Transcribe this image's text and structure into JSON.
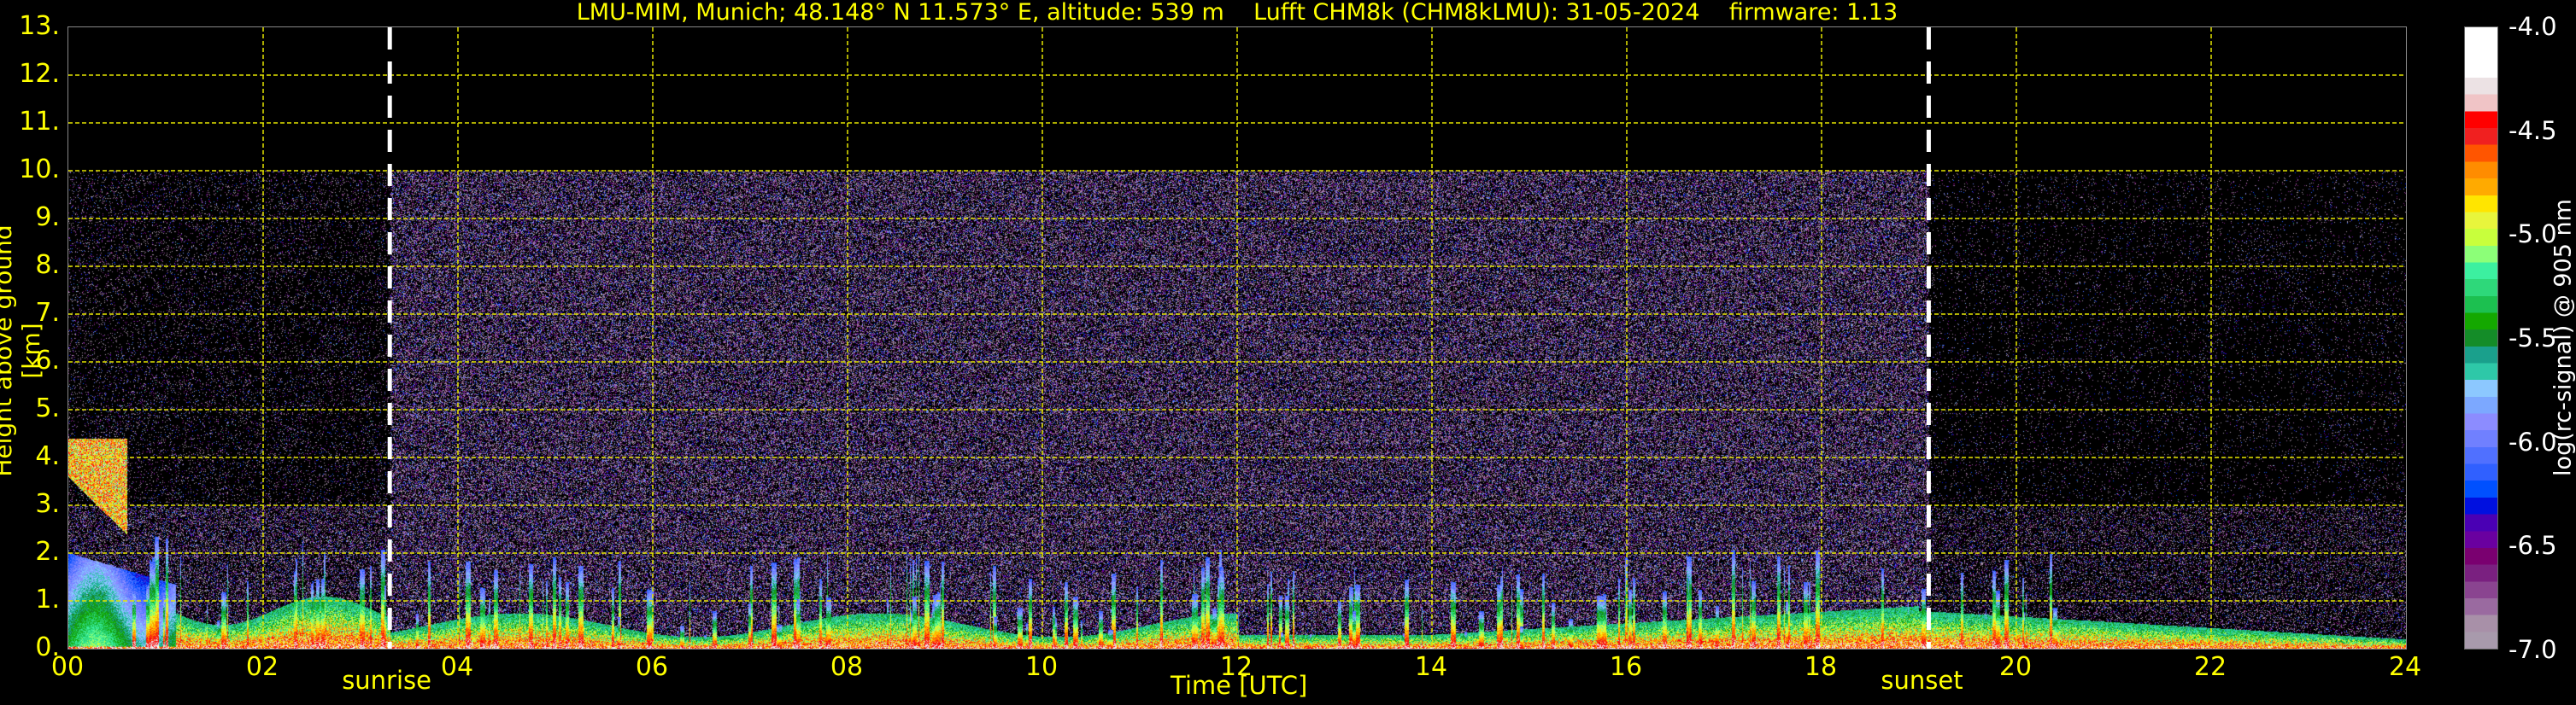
{
  "chart_data": {
    "type": "heatmap",
    "title": "LMU-MIM, Munich; 48.148° N 11.573° E, altitude: 539 m    Lufft CHM8k (CHM8kLMU): 31-05-2024    firmware: 1.13",
    "xlabel": "Time [UTC]",
    "ylabel": "Height above ground [km]",
    "xlim": [
      0,
      24
    ],
    "ylim": [
      0,
      13
    ],
    "grid": true,
    "x_ticks": [
      0,
      2,
      4,
      6,
      8,
      10,
      12,
      14,
      16,
      18,
      20,
      22,
      24
    ],
    "x_tick_labels": [
      "00",
      "02",
      "04",
      "06",
      "08",
      "10",
      "12",
      "14",
      "16",
      "18",
      "20",
      "22",
      "24"
    ],
    "y_ticks": [
      0,
      1,
      2,
      3,
      4,
      5,
      6,
      7,
      8,
      9,
      10,
      11,
      12,
      13
    ],
    "y_tick_labels": [
      "0.",
      "1.",
      "2.",
      "3.",
      "4.",
      "5.",
      "6.",
      "7.",
      "8.",
      "9.",
      "10.",
      "11.",
      "12.",
      "13."
    ],
    "annotations": [
      {
        "text": "sunrise",
        "x": 3.3
      },
      {
        "text": "sunset",
        "x": 19.1
      }
    ],
    "signal_top_km": 10,
    "colorbar": {
      "label": "log(rc-signal) @ 905 nm",
      "range": [
        -7.0,
        -4.0
      ],
      "tick_labels": [
        "-4.0",
        "-4.5",
        "-5.0",
        "-5.5",
        "-6.0",
        "-6.5",
        "-7.0"
      ],
      "ticks": [
        -4.0,
        -4.5,
        -5.0,
        -5.5,
        -6.0,
        -6.5,
        -7.0
      ],
      "colors_top_to_bottom": [
        "#ffffff",
        "#ffffff",
        "#ffffff",
        "#ece2e4",
        "#f0c4c6",
        "#ff0000",
        "#f02020",
        "#ff5500",
        "#ff8c00",
        "#ffaa00",
        "#ffe500",
        "#e8f53c",
        "#c8ff3c",
        "#8cff78",
        "#3cf0a0",
        "#2ed87a",
        "#1cc050",
        "#14a800",
        "#148c28",
        "#1aa08c",
        "#2ec8a8",
        "#8cc8ff",
        "#7ca8ff",
        "#8c8cff",
        "#7080ff",
        "#5070ff",
        "#3060ff",
        "#0050ff",
        "#0010e0",
        "#4a00b4",
        "#6a00a0",
        "#7a0070",
        "#7a2080",
        "#8a4490",
        "#9a6aa0",
        "#a890a8",
        "#a89aac"
      ]
    },
    "description_series": "range-corrected backscatter signal vs time and height (rendered procedurally)"
  }
}
